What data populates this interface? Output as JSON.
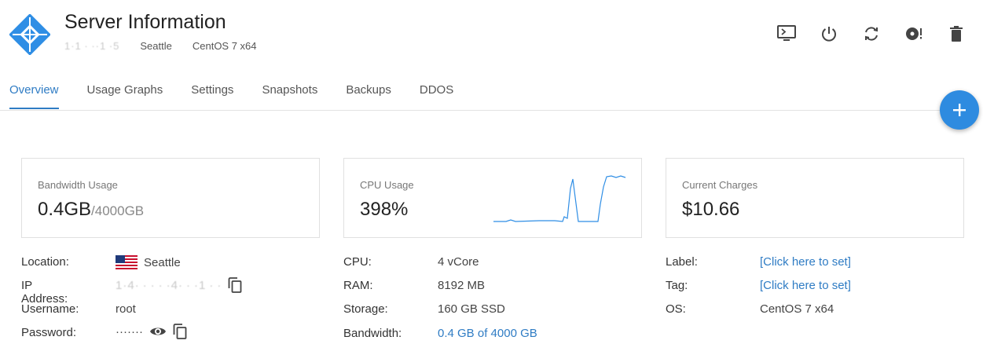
{
  "header": {
    "title": "Server Information",
    "ip_masked": "1·1 · ··1 ·5",
    "location": "Seattle",
    "os": "CentOS 7 x64"
  },
  "actions": [
    "console-icon",
    "power-icon",
    "restart-icon",
    "reinstall-icon",
    "delete-icon"
  ],
  "tabs": [
    "Overview",
    "Usage Graphs",
    "Settings",
    "Snapshots",
    "Backups",
    "DDOS"
  ],
  "active_tab": "Overview",
  "cards": {
    "bandwidth": {
      "label": "Bandwidth Usage",
      "value": "0.4GB",
      "suffix": "/4000GB"
    },
    "cpu": {
      "label": "CPU Usage",
      "value": "398%"
    },
    "charges": {
      "label": "Current Charges",
      "value": "$10.66"
    }
  },
  "details_left": {
    "location_label": "Location:",
    "location": "Seattle",
    "ip_label": "IP Address:",
    "ip": "1·​4· · · · ·4· · ·1 · ·",
    "username_label": "Username:",
    "username": "root",
    "password_label": "Password:",
    "password": "·······"
  },
  "details_mid": {
    "cpu_label": "CPU:",
    "cpu": "4 vCore",
    "ram_label": "RAM:",
    "ram": "8192 MB",
    "storage_label": "Storage:",
    "storage": "160 GB SSD",
    "bandwidth_label": "Bandwidth:",
    "bandwidth": "0.4 GB of 4000 GB"
  },
  "details_right": {
    "label_label": "Label:",
    "label": "[Click here to set]",
    "tag_label": "Tag:",
    "tag": "[Click here to set]",
    "os_label": "OS:",
    "os": "CentOS 7 x64"
  },
  "colors": {
    "accent": "#2f7cc4",
    "fab": "#2e8be0",
    "logo": "#2f8ee5"
  }
}
